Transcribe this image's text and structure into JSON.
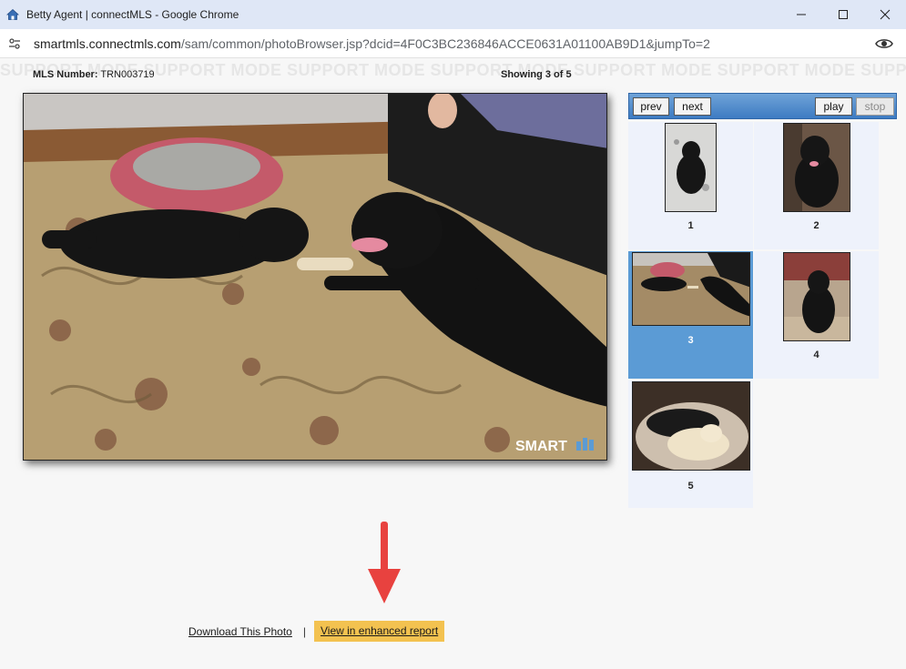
{
  "window": {
    "title": "Betty Agent | connectMLS - Google Chrome",
    "url_domain": "smartmls.connectmls.com",
    "url_path": "/sam/common/photoBrowser.jsp?dcid=4F0C3BC236846ACCE0631A01100AB9D1&jumpTo=2"
  },
  "page": {
    "watermark": "SUPPORT MODE SUPPORT MODE SUPPORT MODE SUPPORT MODE SUPPORT MODE SUPPORT MODE SUPPORT MODE",
    "mls_label": "MLS Number:",
    "mls_number": "TRN003719",
    "showing": "Showing 3 of 5",
    "photo_brand": "SMART"
  },
  "thumbs": {
    "prev_label": "prev",
    "next_label": "next",
    "play_label": "play",
    "stop_label": "stop",
    "items": [
      {
        "number": "1"
      },
      {
        "number": "2"
      },
      {
        "number": "3",
        "selected": true
      },
      {
        "number": "4"
      },
      {
        "number": "5"
      }
    ]
  },
  "links": {
    "download": "Download This Photo",
    "separator": "|",
    "enhanced": "View in enhanced report"
  },
  "colors": {
    "selected_thumb": "#5b9bd5",
    "highlight": "#f3c250",
    "arrow": "#e8423f"
  }
}
